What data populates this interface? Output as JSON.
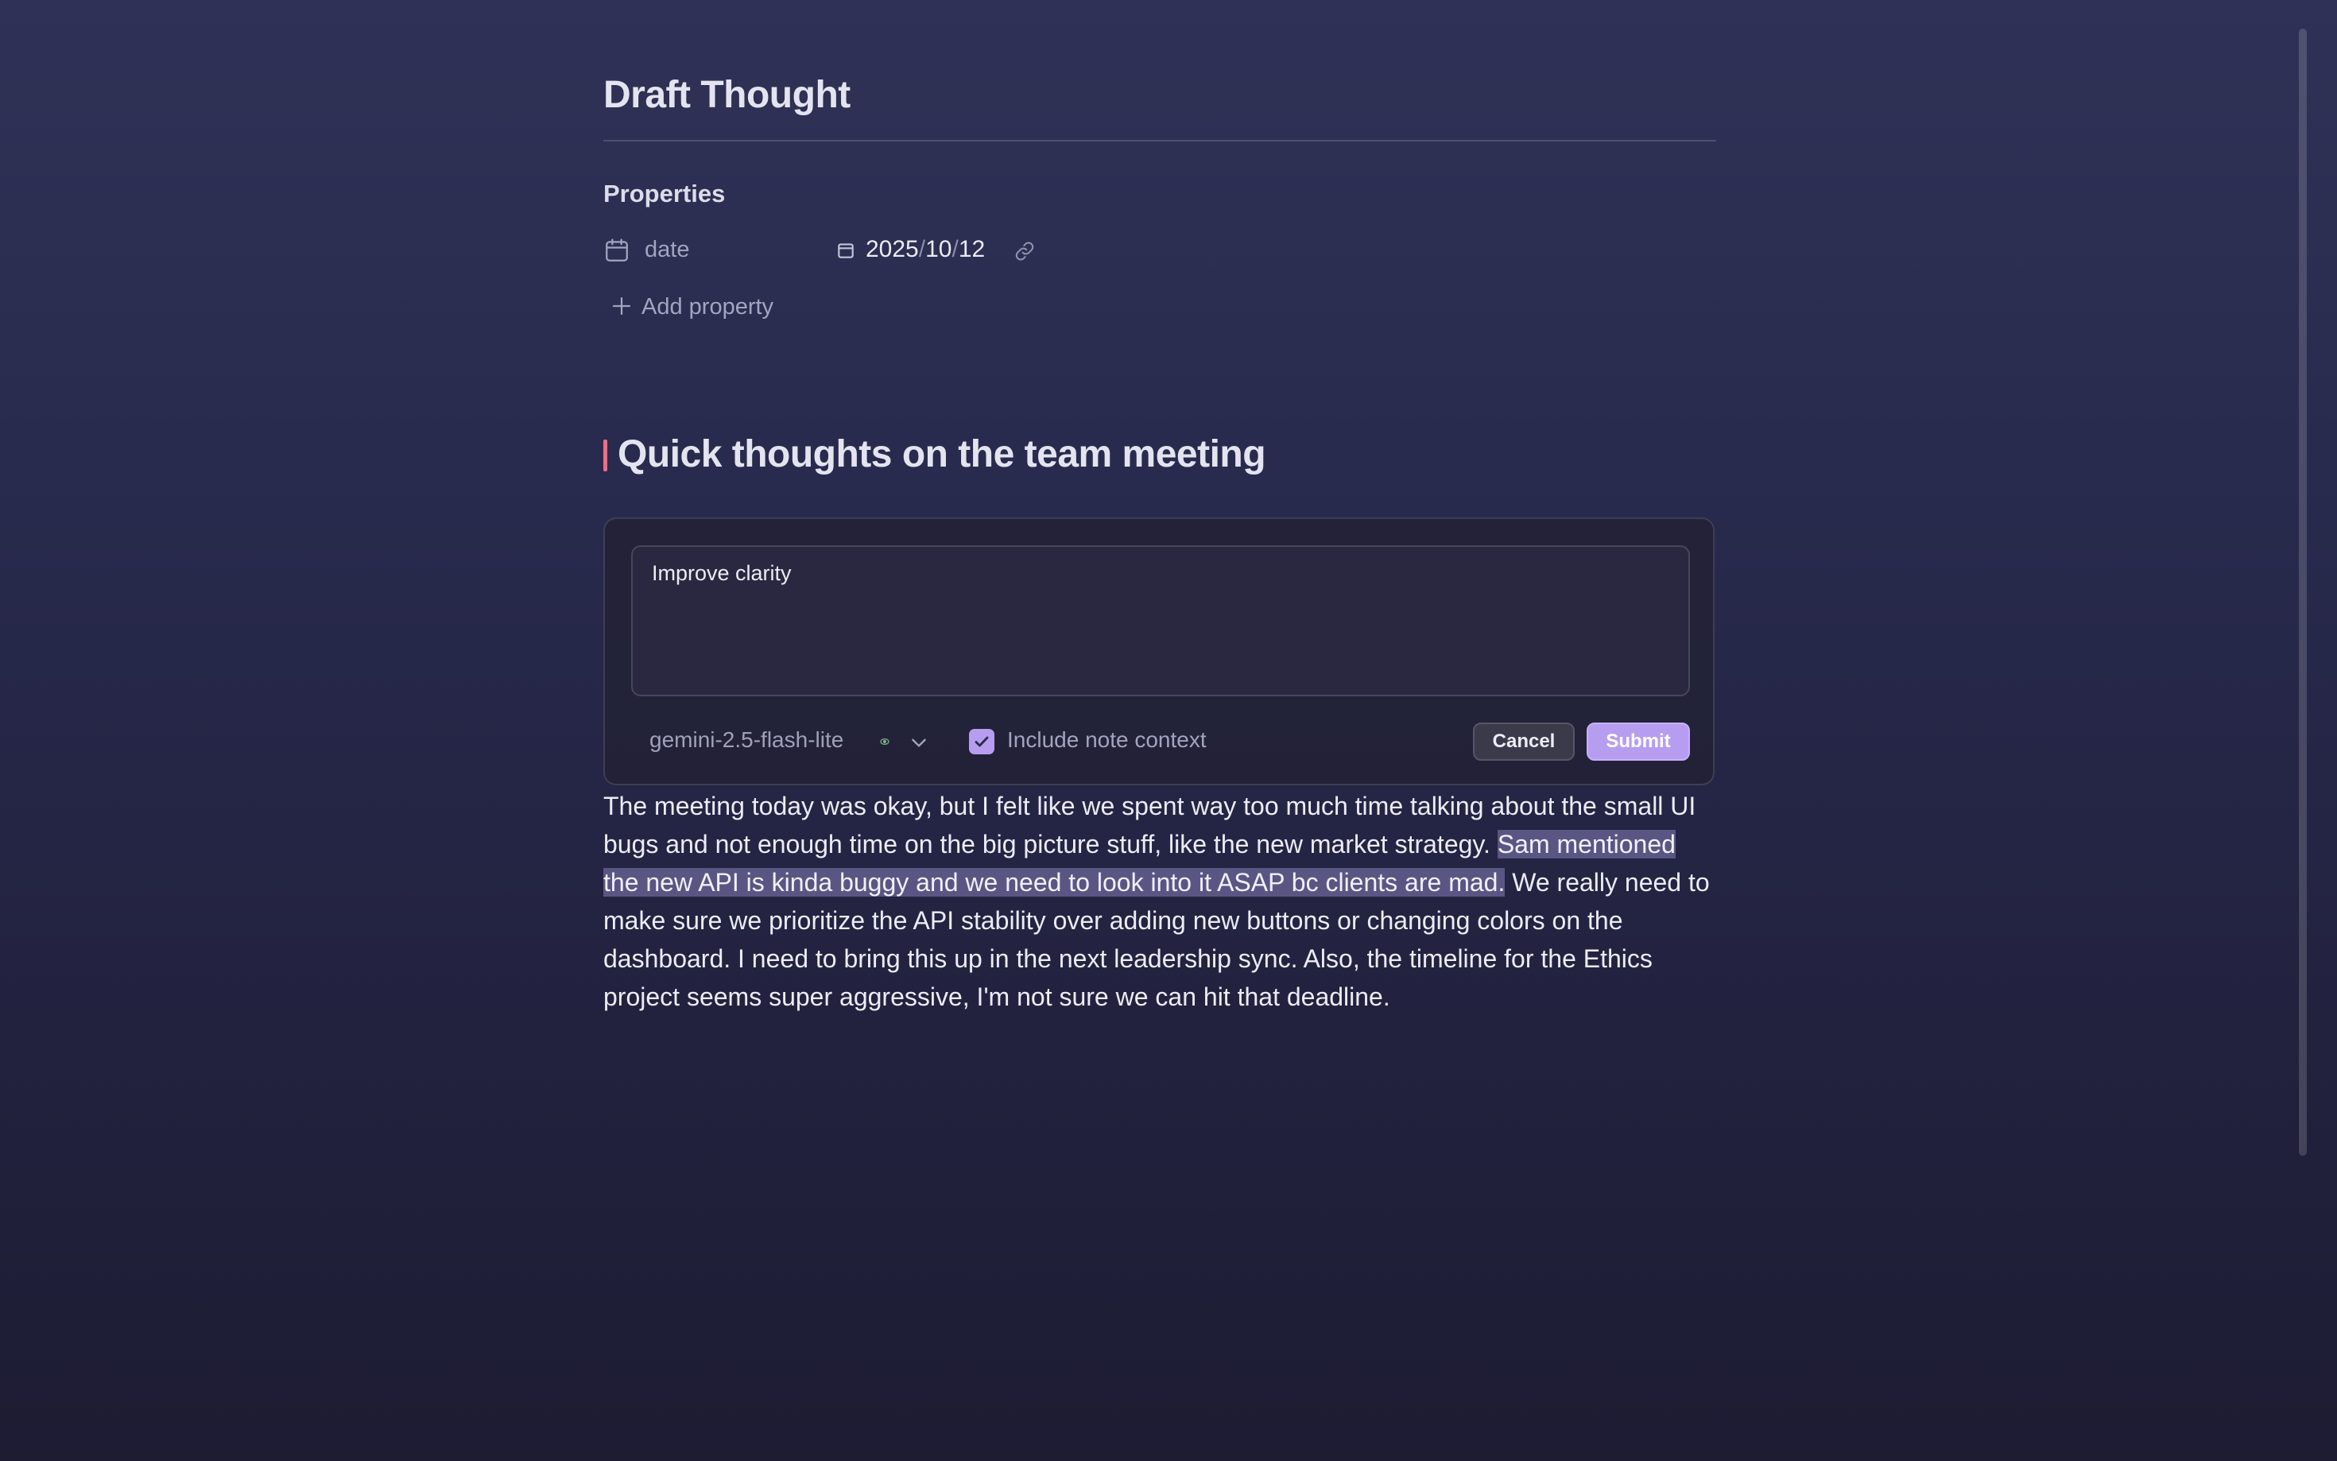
{
  "note": {
    "title": "Draft Thought"
  },
  "properties": {
    "heading": "Properties",
    "items": [
      {
        "key": "date",
        "key_icon": "calendar-icon",
        "value_icon": "calendar-icon",
        "value": {
          "year": "2025",
          "month": "10",
          "day": "12",
          "separator": "/"
        },
        "action_icon": "link-icon"
      }
    ],
    "add_label": "Add property",
    "add_icon": "plus-icon"
  },
  "content": {
    "heading": "Quick thoughts on the team meeting",
    "heading_marker_color": "#ee6f82",
    "paragraph": {
      "before": "The meeting today was okay, but I felt like we spent way too much time talking about the small UI bugs and not enough time on the big picture stuff, like the new market strategy. ",
      "selected": "Sam mentioned the new API is kinda buggy and we need to look into it ASAP bc clients are mad.",
      "after": " We really need to make sure we prioritize the API stability over adding new buttons or changing colors on the dashboard. I need to bring this up in the next leadership sync. Also, the timeline for the Ethics project seems super aggressive, I'm not sure we can hit that deadline."
    }
  },
  "ai_panel": {
    "prompt": "Improve clarity",
    "model": {
      "name": "gemini-2.5-flash-lite",
      "status_icon": "eye-icon",
      "dropdown_icon": "chevron-down-icon"
    },
    "include_context": {
      "label": "Include note context",
      "checked": true
    },
    "cancel_label": "Cancel",
    "submit_label": "Submit",
    "accent_color": "#b79df0"
  }
}
